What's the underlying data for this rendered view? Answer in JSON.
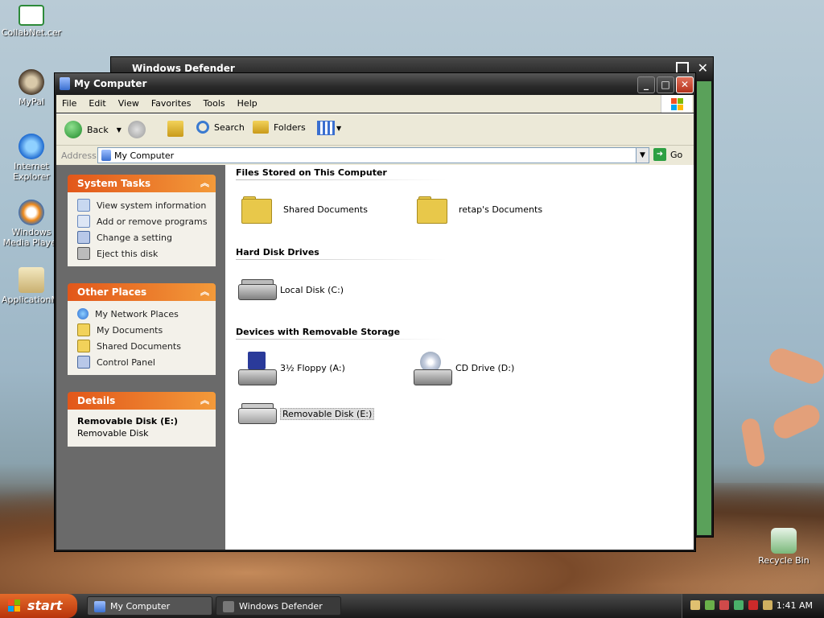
{
  "desktop": {
    "icons": [
      {
        "label": "CollabNet.cer"
      },
      {
        "label": "MyPal"
      },
      {
        "label": "Internet Explorer"
      },
      {
        "label": "Windows Media Player"
      },
      {
        "label": "ApplicationMi"
      },
      {
        "label": "Recycle Bin"
      }
    ]
  },
  "background_window": {
    "title": "Windows Defender"
  },
  "window": {
    "title": "My Computer",
    "menu": [
      "File",
      "Edit",
      "View",
      "Favorites",
      "Tools",
      "Help"
    ],
    "toolbar": {
      "back": "Back",
      "search": "Search",
      "folders": "Folders"
    },
    "address": {
      "label": "Address",
      "value": "My Computer",
      "go": "Go"
    },
    "left_panels": {
      "system_tasks": {
        "title": "System Tasks",
        "items": [
          "View system information",
          "Add or remove programs",
          "Change a setting",
          "Eject this disk"
        ]
      },
      "other_places": {
        "title": "Other Places",
        "items": [
          "My Network Places",
          "My Documents",
          "Shared Documents",
          "Control Panel"
        ]
      },
      "details": {
        "title": "Details",
        "name": "Removable Disk (E:)",
        "type": "Removable Disk"
      }
    },
    "sections": {
      "files_stored": {
        "title": "Files Stored on This Computer",
        "items": [
          "Shared Documents",
          "retap's Documents"
        ]
      },
      "hard_disks": {
        "title": "Hard Disk Drives",
        "items": [
          "Local Disk (C:)"
        ]
      },
      "removable": {
        "title": "Devices with Removable Storage",
        "items": [
          "3½ Floppy (A:)",
          "CD Drive (D:)",
          "Removable Disk (E:)"
        ]
      }
    }
  },
  "taskbar": {
    "start": "start",
    "tasks": [
      "My Computer",
      "Windows Defender"
    ],
    "clock": "1:41 AM"
  },
  "colors": {
    "panel_header": "#e2571a",
    "taskbar": "#1a1a1a",
    "start_button": "#d24f1a"
  }
}
